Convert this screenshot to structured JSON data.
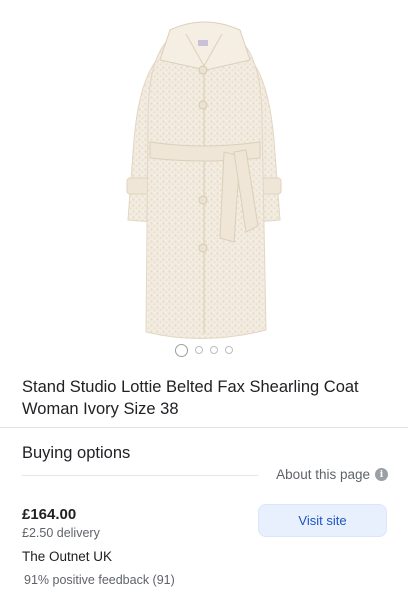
{
  "product": {
    "title": "Stand Studio Lottie Belted Fax Shearling Coat Woman Ivory Size 38",
    "image": "ivory belted shearling coat",
    "gallery_count": 4,
    "gallery_active_index": 0
  },
  "buying_options": {
    "heading": "Buying options",
    "about_label": "About this page",
    "about_icon": "info-icon"
  },
  "offer": {
    "price": "£164.00",
    "delivery": "£2.50 delivery",
    "seller": "The Outnet UK",
    "feedback": "91% positive feedback (91)",
    "visit_label": "Visit site"
  },
  "colors": {
    "coat": "#f2ebdf",
    "button_bg": "#e8f0fe",
    "button_text": "#1a56c4"
  }
}
